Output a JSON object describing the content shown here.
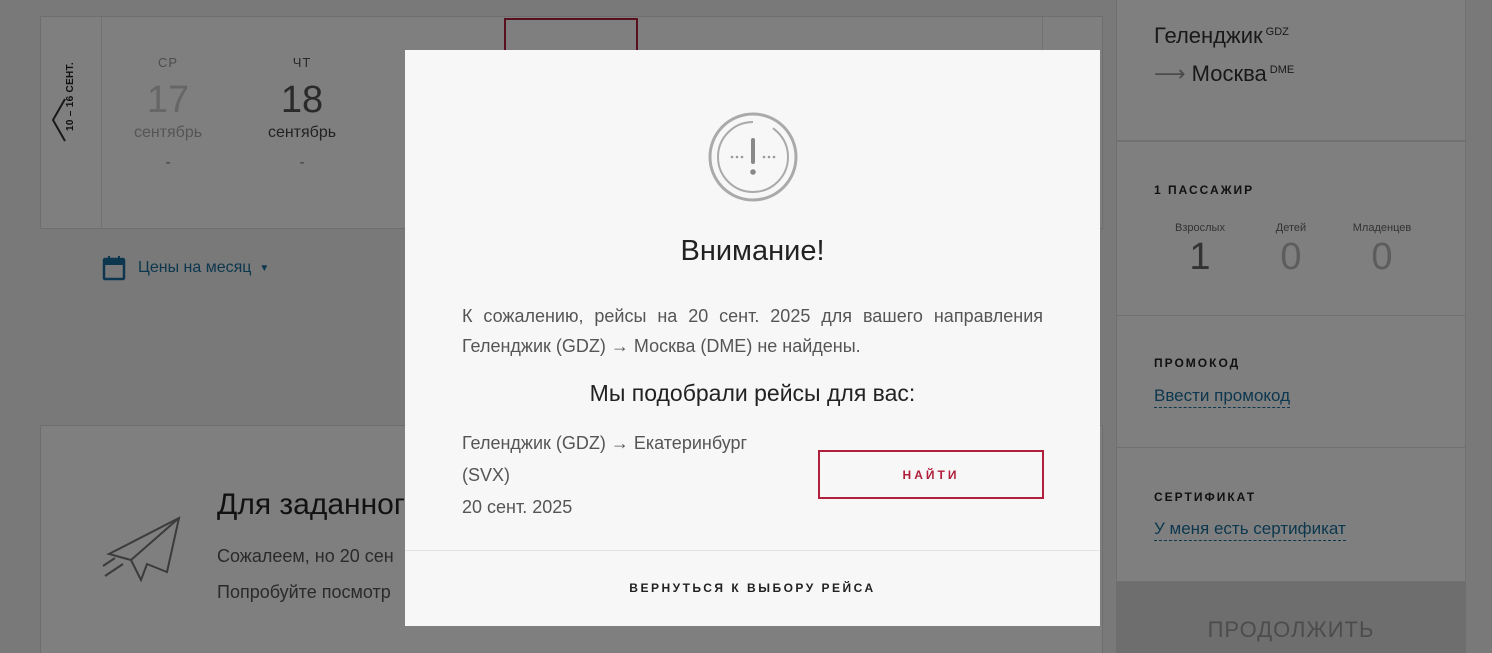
{
  "calendar": {
    "prev_range": "10 – 16 СЕНТ.",
    "days": [
      {
        "dow": "СР",
        "num": "17",
        "month": "сентябрь",
        "price": "-"
      },
      {
        "dow": "ЧТ",
        "num": "18",
        "month": "сентябрь",
        "price": "-"
      }
    ]
  },
  "month_prices": {
    "label": "Цены на месяц"
  },
  "empty_state": {
    "title": "Для заданного",
    "line1": "Сожалеем, но 20 сен",
    "line2": "Попробуйте посмотр"
  },
  "sidebar": {
    "route": {
      "from": "Геленджик",
      "from_code": "GDZ",
      "arrow": "⟶",
      "to": "Москва",
      "to_code": "DME"
    },
    "passengers": {
      "title": "1 ПАССАЖИР",
      "adults_label": "Взрослых",
      "adults": "1",
      "children_label": "Детей",
      "children": "0",
      "infants_label": "Младенцев",
      "infants": "0"
    },
    "promo": {
      "title": "ПРОМОКОД",
      "link": "Ввести промокод"
    },
    "certificate": {
      "title": "СЕРТИФИКАТ",
      "link": "У меня есть сертификат"
    },
    "continue_label": "ПРОДОЛЖИТЬ"
  },
  "modal": {
    "title": "Внимание!",
    "message": "К сожалению, рейсы на 20 сент. 2025 для вашего направления Геленджик (GDZ) → Москва (DME) не найдены.",
    "subtitle": "Мы подобрали рейсы для вас:",
    "alt_route": "Геленджик (GDZ) → Екатеринбург (SVX)",
    "alt_date": "20 сент. 2025",
    "find_label": "НАЙТИ",
    "back_label": "ВЕРНУТЬСЯ К ВЫБОРУ РЕЙСА"
  },
  "colors": {
    "accent": "#b0203c",
    "link": "#1a6f9c"
  }
}
